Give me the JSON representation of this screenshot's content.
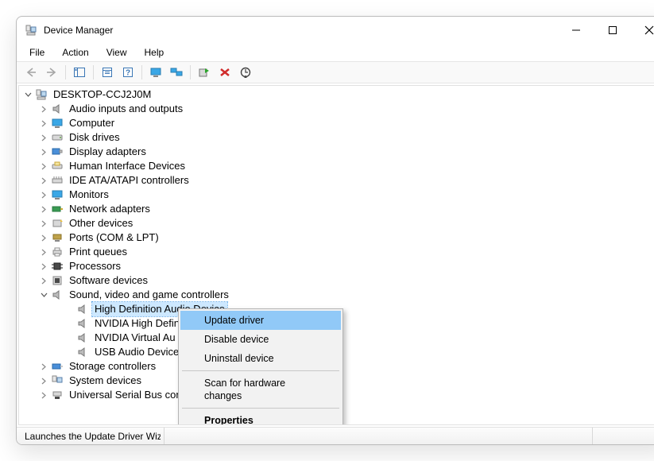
{
  "title": "Device Manager",
  "menubar": [
    "File",
    "Action",
    "View",
    "Help"
  ],
  "toolbar": {
    "back": "Back",
    "forward": "Forward",
    "up": "Show/Hide Console Tree",
    "properties": "Properties",
    "help": "Help",
    "monitor": "View",
    "monitors": "Show hidden devices",
    "update": "Update driver",
    "remove": "Uninstall device",
    "scan": "Scan for hardware changes"
  },
  "tree": {
    "root": "DESKTOP-CCJ2J0M",
    "categories": [
      "Audio inputs and outputs",
      "Computer",
      "Disk drives",
      "Display adapters",
      "Human Interface Devices",
      "IDE ATA/ATAPI controllers",
      "Monitors",
      "Network adapters",
      "Other devices",
      "Ports (COM & LPT)",
      "Print queues",
      "Processors",
      "Software devices",
      "Sound, video and game controllers",
      "Storage controllers",
      "System devices",
      "Universal Serial Bus controllers"
    ],
    "expanded_children": [
      "High Definition Audio Device",
      "NVIDIA High Definition Audio",
      "NVIDIA Virtual Audio Device",
      "USB Audio Device"
    ],
    "truncated_children": [
      "NVIDIA High Defin",
      "NVIDIA Virtual Au",
      "USB Audio Device"
    ]
  },
  "context_menu": {
    "update": "Update driver",
    "disable": "Disable device",
    "uninstall": "Uninstall device",
    "scan": "Scan for hardware changes",
    "properties": "Properties"
  },
  "statusbar": "Launches the Update Driver Wizard for the selected device."
}
